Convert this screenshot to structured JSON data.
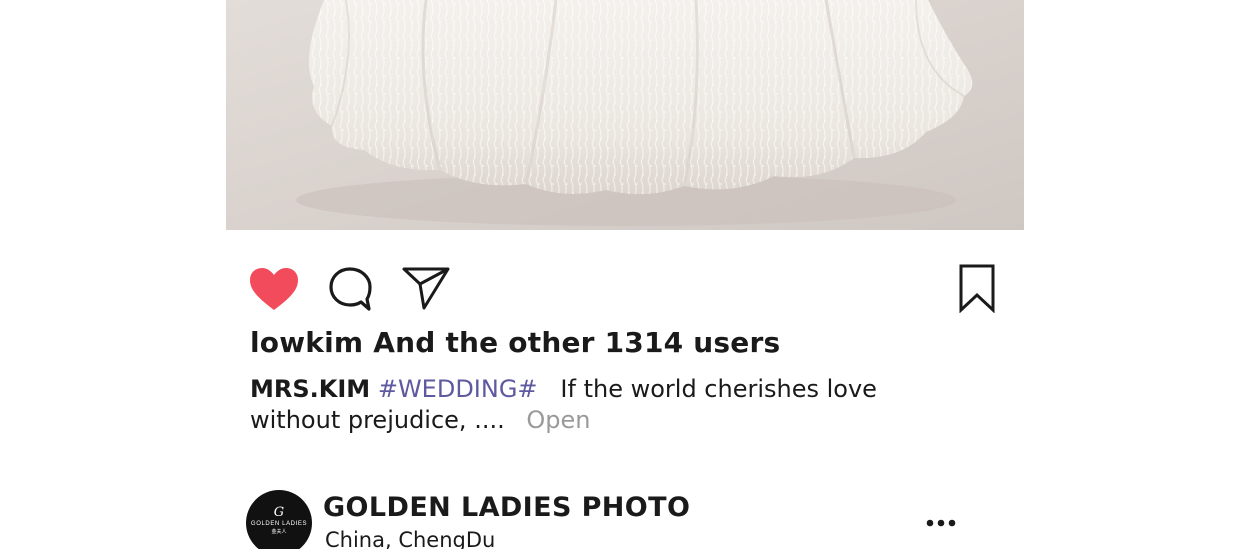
{
  "post": {
    "image": {
      "subject": "white lace wedding dress hem"
    },
    "actions": {
      "like_icon": "heart-filled-icon",
      "comment_icon": "comment-bubble-icon",
      "share_icon": "paper-plane-icon",
      "save_icon": "bookmark-icon",
      "like_color": "#f24b5b"
    },
    "likes_text": "lowkim And the other 1314 users",
    "caption": {
      "author": "MRS.KIM",
      "hashtag": "#WEDDING#",
      "text": "If the world cherishes love without prejudice, ....",
      "open_label": "Open"
    }
  },
  "account": {
    "avatar": {
      "monogram": "G",
      "brand": "GOLDEN LADIES",
      "brand_sub": "金夫人"
    },
    "name": "GOLDEN LADIES PHOTO",
    "location": "China,  ChengDu",
    "more_icon": "more-dots-icon"
  }
}
